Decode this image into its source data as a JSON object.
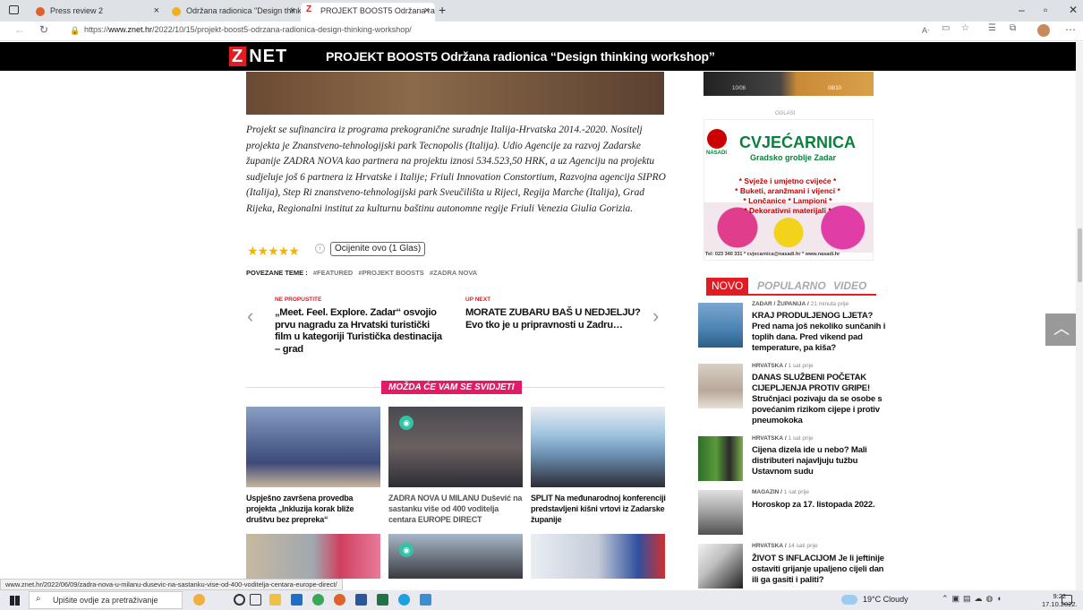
{
  "browser": {
    "tabs": [
      {
        "label": "Press review 2",
        "icon_color": "#e0622b"
      },
      {
        "label": "Održana radionica \"Design think",
        "icon_color": "#f0b020"
      },
      {
        "label": "PROJEKT BOOST5 Održana radio",
        "icon_color": "#e31b23"
      }
    ],
    "url_prefix": "https://",
    "url_host": "www.znet.hr",
    "url_path": "/2022/10/15/projekt-boost5-odrzana-radionica-design-thinking-workshop/",
    "status_url": "www.znet.hr/2022/06/09/zadra-nova-u-milanu-dusevic-na-sastanku-vise-od-400-voditelja-centara-europe-direct/"
  },
  "header": {
    "logo_z": "Z",
    "logo_rest": "NET",
    "title": "PROJEKT BOOST5 Održana radionica “Design thinking workshop”"
  },
  "article": {
    "paragraph": "Projekt se sufinancira iz programa prekogranične suradnje Italija-Hrvatska 2014.-2020. Nositelj projekta je Znanstveno-tehnologijski park Tecnopolis (Italija). Udio Agencije za razvoj Zadarske županije ZADRA NOVA kao partnera na projektu iznosi 534.523,50 HRK, a uz Agenciju na projektu sudjeluje još 6 partnera iz Hrvatske i Italije; Friuli Innovation Constortium, Razvojna agencija SIPRO (Italija), Step Ri znanstveno-tehnologijski park Sveučilišta u Rijeci, Regija Marche (Italija), Grad Rijeka, Regionalni institut za kulturnu baštinu autonomne regije Friuli Venezia Giulia Gorizia.",
    "rating_stars": 5,
    "rating_label": "Ocijenite ovo (1 Glas)",
    "tags_label": "POVEZANE TEME :",
    "tags": [
      "#FEATURED",
      "#PROJEKT BOOSTS",
      "#ZADRA NOVA"
    ],
    "prev_label": "NE PROPUSTITE",
    "prev_title": "„Meet. Feel. Explore. Zadar“ osvojio prvu nagradu za Hrvatski turistički film u kategoriji Turistička destinacija – grad",
    "next_label": "UP NEXT",
    "next_title": "MORATE ZUBARU BAŠ U NEDJELJU? Evo tko je u pripravnosti u Zadru…",
    "related_heading": "MOŽDA ĆE VAM SE SVIDJETI",
    "related": [
      {
        "title": "Uspješno završena provedba projekta „Inkluzija korak bliže društvu bez prepreka“"
      },
      {
        "title": "ZADRA NOVA U MILANU Dušević na sastanku više od 400 voditelja centara EUROPE DIRECT"
      },
      {
        "title": "SPLIT Na međunarodnoj konferenciji predstavljeni kišni vrtovi iz Zadarske županije"
      }
    ]
  },
  "sidebar": {
    "ad_top_left": "10/08",
    "ad_top_right": "08/10",
    "ad_label": "OGLASI",
    "ad_brand": "NASADI",
    "ad_title": "CVJEĆARNICA",
    "ad_subtitle": "Gradsko groblje Zadar",
    "ad_lines": [
      "* Svježe i umjetno cvijeće *",
      "* Buketi, aranžmani i vijenci *",
      "* Lončanice * Lampioni *",
      "* Dekorativni materijali *"
    ],
    "ad_tel": "Tel: 023 340 331 * cvjecarnica@nasadi.hr * www.nasadi.hr",
    "tabs": [
      "NOVO",
      "POPULARNO",
      "VIDEO"
    ],
    "news": [
      {
        "cat": "ZADAR / ŽUPANIJA",
        "time": "21 minuta prije",
        "title": "KRAJ PRODULJENOG LJETA? Pred nama još nekoliko sunčanih i toplih dana. Pred vikend pad temperature, pa kiša?"
      },
      {
        "cat": "HRVATSKA",
        "time": "1 sat prije",
        "title": "DANAS SLUŽBENI POČETAK CIJEPLJENJA PROTIV GRIPE! Stručnjaci pozivaju da se osobe s povećanim rizikom cijepe i protiv pneumokoka"
      },
      {
        "cat": "HRVATSKA",
        "time": "1 sat prije",
        "title": "Cijena dizela ide u nebo? Mali distributeri najavljuju tužbu Ustavnom sudu"
      },
      {
        "cat": "MAGAZIN",
        "time": "1 sat prije",
        "title": "Horoskop za 17. listopada 2022."
      },
      {
        "cat": "HRVATSKA",
        "time": "14 sati prije",
        "title": "ŽIVOT S INFLACIJOM Je li jeftinije ostaviti grijanje upaljeno cijeli dan ili ga gasiti i paliti?"
      }
    ]
  },
  "taskbar": {
    "search_placeholder": "Upišite ovdje za pretraživanje",
    "weather": "19°C  Cloudy",
    "time": "9:22",
    "date": "17.10.2022."
  }
}
